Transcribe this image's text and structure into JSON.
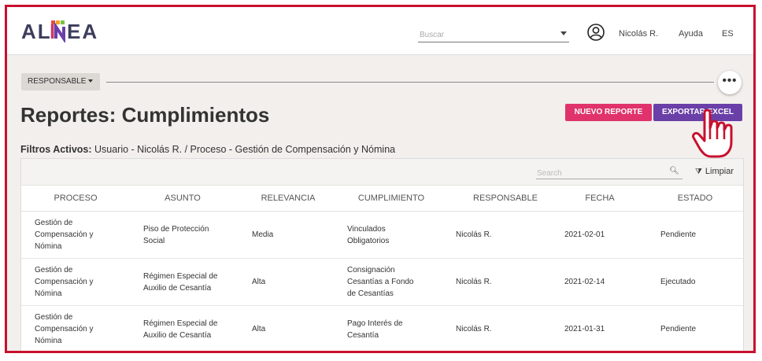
{
  "header": {
    "logo": "ALINEA",
    "search_placeholder": "Buscar",
    "user": "Nicolás R.",
    "help": "Ayuda",
    "lang": "ES"
  },
  "toolbar": {
    "responsable_label": "RESPONSABLE",
    "more_label": "•••"
  },
  "page": {
    "title": "Reportes: Cumplimientos",
    "btn_new": "NUEVO REPORTE",
    "btn_excel": "EXPORTAR EXCEL",
    "filters_label": "Filtros Activos:",
    "filters_value": " Usuario - Nicolás R. / Proceso - Gestión de Compensación y Nómina"
  },
  "table": {
    "search_placeholder": "Search",
    "clear_label": "Limpiar",
    "columns": [
      "PROCESO",
      "ASUNTO",
      "RELEVANCIA",
      "CUMPLIMIENTO",
      "RESPONSABLE",
      "FECHA",
      "ESTADO"
    ],
    "rows": [
      {
        "proceso": [
          "Gestión de",
          "Compensación y",
          "Nómina"
        ],
        "asunto": [
          "Piso de Protección",
          "Social"
        ],
        "relevancia": "Media",
        "cumplimiento": [
          "Vinculados",
          "Obligatorios"
        ],
        "responsable": "Nicolás R.",
        "fecha": "2021-02-01",
        "estado": "Pendiente"
      },
      {
        "proceso": [
          "Gestión de",
          "Compensación y",
          "Nómina"
        ],
        "asunto": [
          "Régimen Especial de",
          "Auxilio de Cesantía"
        ],
        "relevancia": "Alta",
        "cumplimiento": [
          "Consignación",
          "Cesantías a Fondo",
          "de Cesantías"
        ],
        "responsable": "Nicolás R.",
        "fecha": "2021-02-14",
        "estado": "Ejecutado"
      },
      {
        "proceso": [
          "Gestión de",
          "Compensación y",
          "Nómina"
        ],
        "asunto": [
          "Régimen Especial de",
          "Auxilio de Cesantía"
        ],
        "relevancia": "Alta",
        "cumplimiento": [
          "Pago Interés de",
          "Cesantía"
        ],
        "responsable": "Nicolás R.",
        "fecha": "2021-01-31",
        "estado": "Pendiente"
      }
    ]
  },
  "colors": {
    "frame_border": "#c8102e",
    "btn_new": "#e0336b",
    "btn_excel": "#6a3fa8",
    "background": "#f2efec"
  }
}
